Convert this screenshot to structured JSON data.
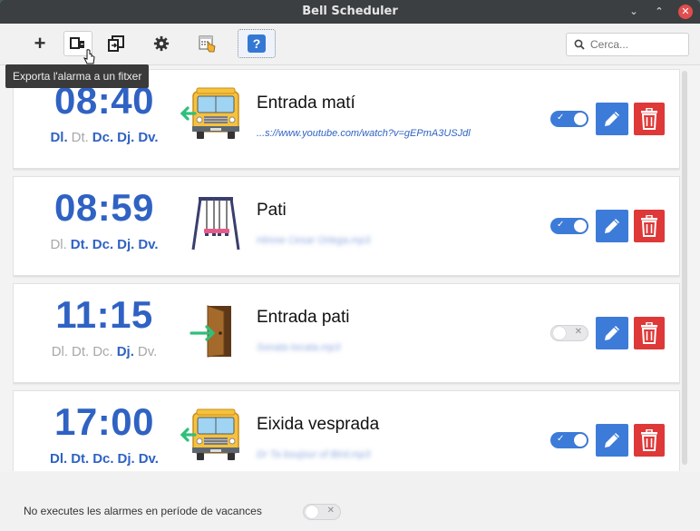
{
  "window": {
    "title": "Bell Scheduler"
  },
  "toolbar": {
    "tooltip": "Exporta l'alarma a un fitxer",
    "search_placeholder": "Cerca...",
    "help_label": "?"
  },
  "alarms": [
    {
      "time": "08:40",
      "name": "Entrada matí",
      "source": "...s://www.youtube.com/watch?v=gEPmA3USJdl",
      "source_blurred": false,
      "icon": "school-bus-icon",
      "enabled": true,
      "days": [
        {
          "label": "Dl.",
          "on": true
        },
        {
          "label": "Dt.",
          "on": false
        },
        {
          "label": "Dc.",
          "on": true
        },
        {
          "label": "Dj.",
          "on": true
        },
        {
          "label": "Dv.",
          "on": true
        }
      ]
    },
    {
      "time": "08:59",
      "name": "Pati",
      "source": "Himne Cesar Ortega.mp3",
      "source_blurred": true,
      "source_suffix": ".mp3",
      "icon": "swing-icon",
      "enabled": true,
      "days": [
        {
          "label": "Dl.",
          "on": false
        },
        {
          "label": "Dt.",
          "on": true
        },
        {
          "label": "Dc.",
          "on": true
        },
        {
          "label": "Dj.",
          "on": true
        },
        {
          "label": "Dv.",
          "on": true
        }
      ]
    },
    {
      "time": "11:15",
      "name": "Entrada pati",
      "source": "Sonata tocata.mp3",
      "source_blurred": true,
      "source_suffix": ".mp3",
      "icon": "door-icon",
      "enabled": false,
      "days": [
        {
          "label": "Dl.",
          "on": false
        },
        {
          "label": "Dt.",
          "on": false
        },
        {
          "label": "Dc.",
          "on": false
        },
        {
          "label": "Dj.",
          "on": true
        },
        {
          "label": "Dv.",
          "on": false
        }
      ]
    },
    {
      "time": "17:00",
      "name": "Eixida vesprada",
      "source": "Dr Ta boujour of Bird.mp3",
      "source_blurred": true,
      "source_suffix": ".mp3",
      "icon": "school-bus-icon",
      "enabled": true,
      "days": [
        {
          "label": "Dl.",
          "on": true
        },
        {
          "label": "Dt.",
          "on": true
        },
        {
          "label": "Dc.",
          "on": true
        },
        {
          "label": "Dj.",
          "on": true
        },
        {
          "label": "Dv.",
          "on": true
        }
      ]
    }
  ],
  "footer": {
    "vacation_label": "No executes les alarmes en període de vacances",
    "vacation_enabled": false
  },
  "colors": {
    "accent": "#2f62c3",
    "edit": "#3d7bd9",
    "delete": "#de3838",
    "titlebar": "#3c3f41"
  }
}
